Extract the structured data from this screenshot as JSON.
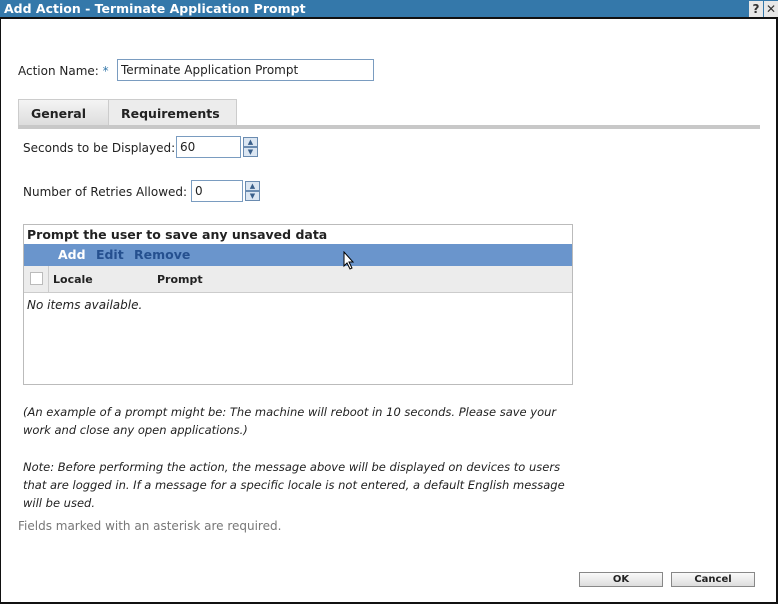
{
  "title": "Add Action - Terminate Application Prompt",
  "help_label": "?",
  "close_label": "✕",
  "action_name": {
    "label": "Action Name:",
    "required": "*",
    "value": "Terminate Application Prompt"
  },
  "tabs": [
    {
      "label": "General"
    },
    {
      "label": "Requirements"
    }
  ],
  "seconds": {
    "label": "Seconds to be Displayed:",
    "value": "60"
  },
  "retries": {
    "label": "Number of Retries Allowed:",
    "value": "0"
  },
  "prompt_panel": {
    "title": "Prompt the user to save any unsaved data",
    "toolbar": {
      "add": "Add",
      "edit": "Edit",
      "remove": "Remove"
    },
    "columns": [
      "Locale",
      "Prompt"
    ],
    "empty": "No items available."
  },
  "example_note": "(An example of a prompt might be: The machine will reboot in 10 seconds. Please save your work and close any open applications.)",
  "note": "Note: Before performing the action, the message above will be displayed on devices to users that are logged in. If a message for a specific locale is not entered, a default English message will be used.",
  "required_note": "Fields marked with an asterisk are required.",
  "ok_label": "OK",
  "cancel_label": "Cancel"
}
